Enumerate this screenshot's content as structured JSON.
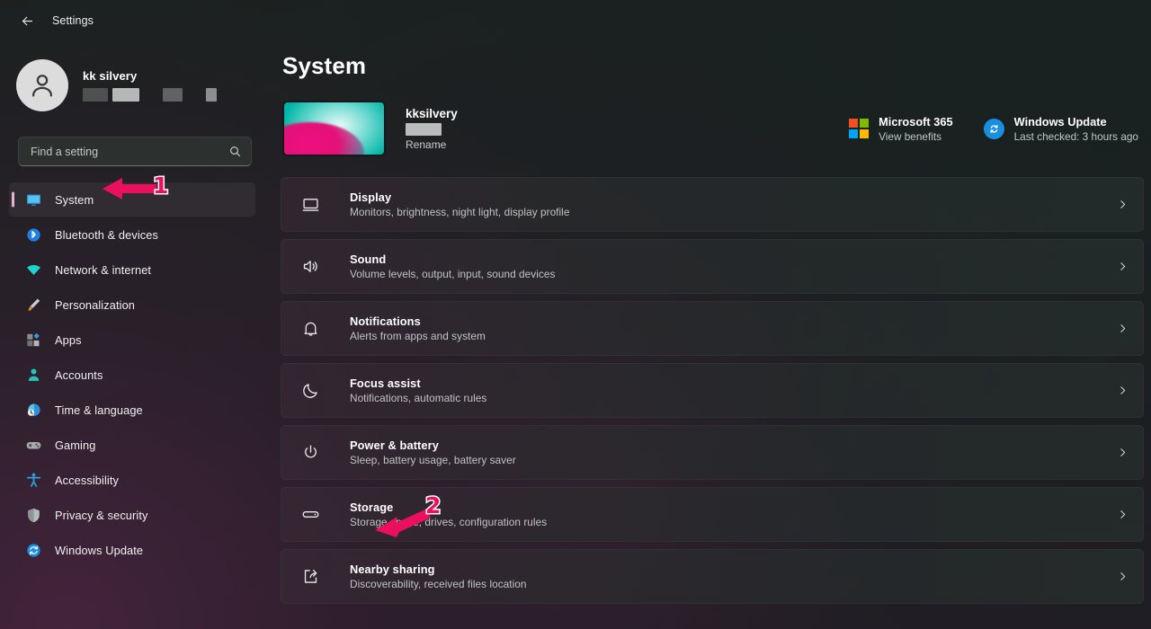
{
  "window": {
    "back_label": "Back",
    "title": "Settings"
  },
  "sidebar": {
    "profile": {
      "name": "kk silvery",
      "account_redacted": true
    },
    "search": {
      "placeholder": "Find a setting",
      "value": "",
      "icon": "search-icon"
    },
    "items": [
      {
        "label": "System",
        "icon": "monitor-icon",
        "selected": true
      },
      {
        "label": "Bluetooth & devices",
        "icon": "bluetooth-icon",
        "selected": false
      },
      {
        "label": "Network & internet",
        "icon": "wifi-icon",
        "selected": false
      },
      {
        "label": "Personalization",
        "icon": "paintbrush-icon",
        "selected": false
      },
      {
        "label": "Apps",
        "icon": "apps-icon",
        "selected": false
      },
      {
        "label": "Accounts",
        "icon": "person-icon",
        "selected": false
      },
      {
        "label": "Time & language",
        "icon": "clock-globe-icon",
        "selected": false
      },
      {
        "label": "Gaming",
        "icon": "gamepad-icon",
        "selected": false
      },
      {
        "label": "Accessibility",
        "icon": "accessibility-icon",
        "selected": false
      },
      {
        "label": "Privacy & security",
        "icon": "shield-icon",
        "selected": false
      },
      {
        "label": "Windows Update",
        "icon": "update-icon",
        "selected": false
      }
    ]
  },
  "main": {
    "page_title": "System",
    "device": {
      "name": "kksilvery",
      "rename_label": "Rename",
      "account_redacted": true
    },
    "cards": [
      {
        "title": "Microsoft 365",
        "subtitle": "View benefits",
        "icon": "microsoft-logo-icon"
      },
      {
        "title": "Windows Update",
        "subtitle": "Last checked: 3 hours ago",
        "icon": "sync-icon"
      }
    ],
    "rows": [
      {
        "title": "Display",
        "subtitle": "Monitors, brightness, night light, display profile",
        "icon": "display-icon"
      },
      {
        "title": "Sound",
        "subtitle": "Volume levels, output, input, sound devices",
        "icon": "speaker-icon"
      },
      {
        "title": "Notifications",
        "subtitle": "Alerts from apps and system",
        "icon": "bell-icon"
      },
      {
        "title": "Focus assist",
        "subtitle": "Notifications, automatic rules",
        "icon": "moon-icon"
      },
      {
        "title": "Power & battery",
        "subtitle": "Sleep, battery usage, battery saver",
        "icon": "power-icon"
      },
      {
        "title": "Storage",
        "subtitle": "Storage space, drives, configuration rules",
        "icon": "drive-icon"
      },
      {
        "title": "Nearby sharing",
        "subtitle": "Discoverability, received files location",
        "icon": "share-icon"
      }
    ]
  },
  "annotations": [
    {
      "number": "1",
      "target": "sidebar-item-system",
      "color": "#ec0f5e"
    },
    {
      "number": "2",
      "target": "settings-row-storage",
      "color": "#ec0f5e"
    }
  ],
  "colors": {
    "accent_pink": "#e7b4d4",
    "annotation": "#ec0f5e",
    "background_top_right": "#1a2020",
    "background_bottom_left": "#261e26",
    "row_background": "#2b3130"
  }
}
